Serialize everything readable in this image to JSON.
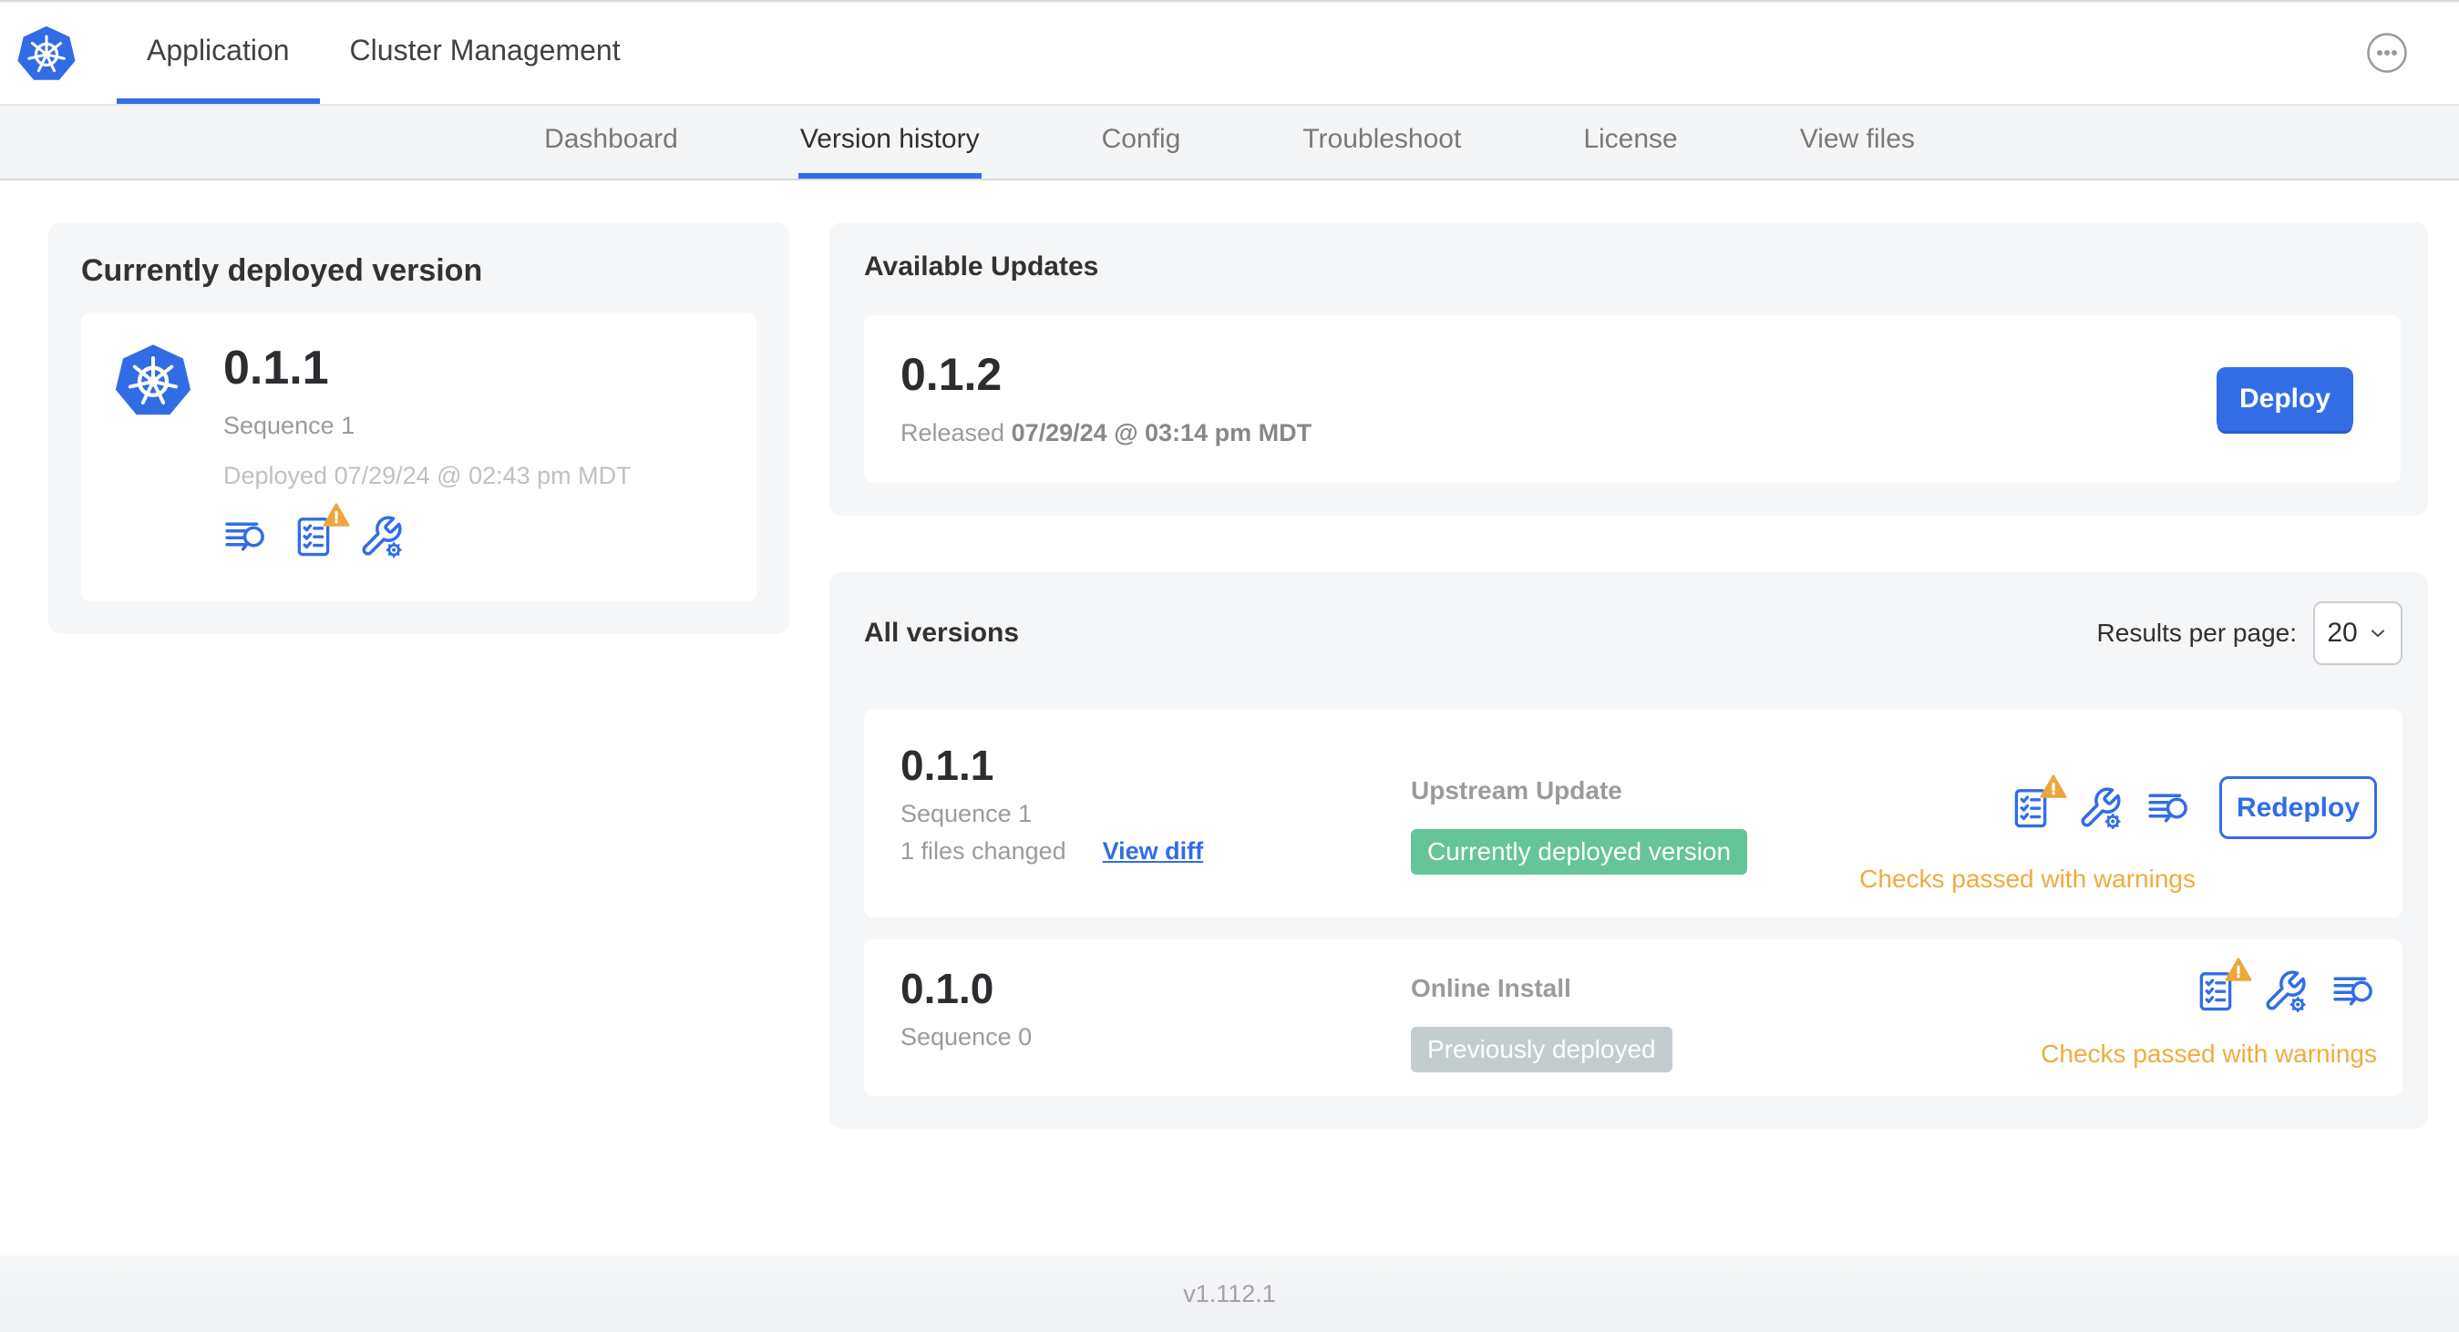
{
  "topnav": {
    "app_tab": "Application",
    "cluster_tab": "Cluster Management"
  },
  "subnav": {
    "dashboard": "Dashboard",
    "version_history": "Version history",
    "config": "Config",
    "troubleshoot": "Troubleshoot",
    "license": "License",
    "view_files": "View files"
  },
  "current": {
    "heading": "Currently deployed version",
    "version": "0.1.1",
    "sequence": "Sequence 1",
    "deployed": "Deployed 07/29/24 @ 02:43 pm MDT"
  },
  "updates": {
    "heading": "Available Updates",
    "version": "0.1.2",
    "released_label": "Released",
    "released_date": "07/29/24 @ 03:14 pm MDT",
    "deploy": "Deploy"
  },
  "versions": {
    "heading": "All versions",
    "results_label": "Results per page:",
    "results_value": "20",
    "rows": [
      {
        "version": "0.1.1",
        "sequence": "Sequence 1",
        "files": "1 files changed",
        "diff": "View diff",
        "source": "Upstream Update",
        "badge": "Currently deployed version",
        "action": "Redeploy",
        "status": "Checks passed with warnings"
      },
      {
        "version": "0.1.0",
        "sequence": "Sequence 0",
        "source": "Online Install",
        "badge": "Previously deployed",
        "status": "Checks passed with warnings"
      }
    ]
  },
  "footer": {
    "version": "v1.112.1"
  },
  "icons": {
    "logo": "kubernetes-logo-icon",
    "overflow": "ellipsis-menu-icon",
    "diff": "log-lines-magnifier-icon",
    "preflight": "preflight-checklist-icon",
    "warning": "warning-triangle-icon",
    "config": "wrench-gear-icon",
    "chevron": "chevron-down-icon"
  },
  "colors": {
    "primary": "#326DE6",
    "logo_blue": "#326CE5",
    "success_badge": "#65C498",
    "muted_badge": "#C3CDCF",
    "warning_text": "#EFAC3E",
    "warning_fill": "#EBA63C",
    "card_bg": "#F5F6F8"
  }
}
